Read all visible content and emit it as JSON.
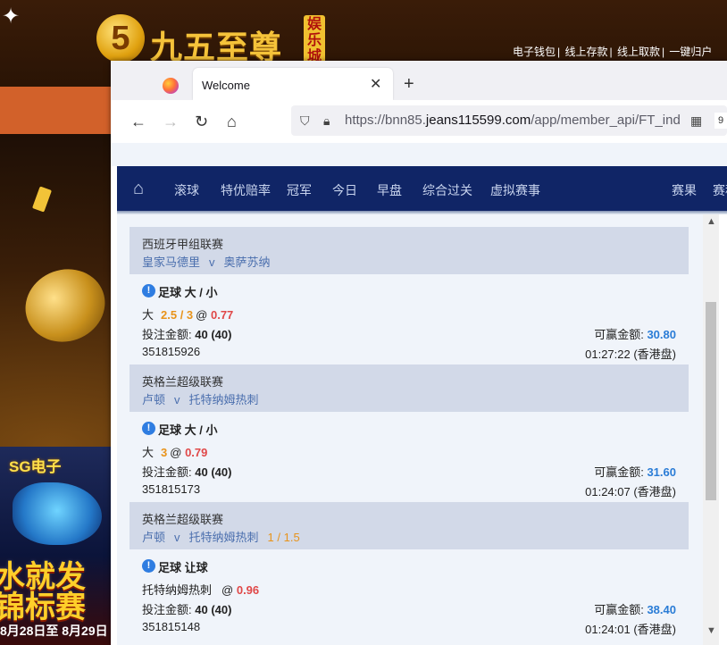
{
  "background_site": {
    "logo_digit": "5",
    "logo_text": "九五至尊",
    "logo_side_text": "娱乐城",
    "top_links": [
      "电子钱包",
      "线上存款",
      "线上取款",
      "一键归户"
    ],
    "banner": {
      "brand": "SG电子",
      "headline": "水就发",
      "subline": "锦标赛",
      "date": "8月28日至 8月29日"
    }
  },
  "browser": {
    "tab_title": "Welcome",
    "url_prefix": "https://bnn85.",
    "url_domain": "jeans115599.com",
    "url_path": "/app/member_api/FT_ind",
    "url_badge": "9"
  },
  "site_nav": {
    "items": [
      "滚球",
      "特优赔率",
      "冠军",
      "今日",
      "早盘",
      "综合过关",
      "虚拟赛事"
    ],
    "right_items": [
      "赛果",
      "赛程"
    ]
  },
  "bets": [
    {
      "league": "西班牙甲组联赛",
      "home": "皇家马德里",
      "vs": "v",
      "away": "奥萨苏纳",
      "handicap": "",
      "bet_type": "足球 大 / 小",
      "pick_label": "大",
      "pick_line": "2.5 / 3",
      "at": "@",
      "odds": "0.77",
      "stake_label": "投注金额:",
      "stake": "40 (40)",
      "win_label": "可赢金额:",
      "win": "30.80",
      "id": "351815926",
      "time": "01:27:22 (香港盘)"
    },
    {
      "league": "英格兰超级联赛",
      "home": "卢顿",
      "vs": "v",
      "away": "托特纳姆热刺",
      "handicap": "",
      "bet_type": "足球 大 / 小",
      "pick_label": "大",
      "pick_line": "3",
      "at": "@",
      "odds": "0.79",
      "stake_label": "投注金额:",
      "stake": "40 (40)",
      "win_label": "可赢金额:",
      "win": "31.60",
      "id": "351815173",
      "time": "01:24:07 (香港盘)"
    },
    {
      "league": "英格兰超级联赛",
      "home": "卢顿",
      "vs": "v",
      "away": "托特纳姆热刺",
      "handicap": "1 / 1.5",
      "bet_type": "足球 让球",
      "pick_label": "托特纳姆热刺",
      "pick_line": "",
      "at": "@",
      "odds": "0.96",
      "stake_label": "投注金额:",
      "stake": "40 (40)",
      "win_label": "可赢金额:",
      "win": "38.40",
      "id": "351815148",
      "time": "01:24:01 (香港盘)"
    }
  ]
}
